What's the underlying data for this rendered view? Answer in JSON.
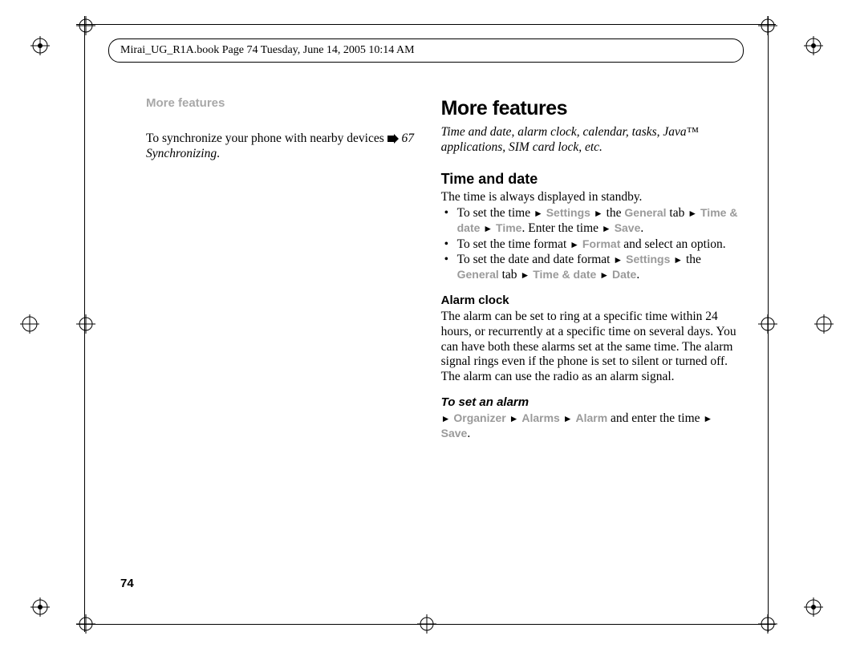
{
  "header": {
    "running_head": "Mirai_UG_R1A.book  Page 74  Tuesday, June 14, 2005  10:14 AM"
  },
  "left_col": {
    "section_label": "More features",
    "sync_text_1": "To synchronize your phone with nearby devices ",
    "sync_xref": "67 Synchronizing",
    "sync_text_2": "."
  },
  "right_col": {
    "big_heading": "More features",
    "tagline": "Time and date, alarm clock, calendar, tasks, Java™ applications, SIM card lock, etc.",
    "time_date_heading": "Time and date",
    "time_date_intro": "The time is always displayed in standby.",
    "bullets": {
      "b1": {
        "t1": "To set the time ",
        "m1": "Settings",
        "t2": " the ",
        "m2": "General",
        "t3": " tab ",
        "m3": "Time & date",
        "m4": "Time",
        "t4": ". Enter the time ",
        "m5": "Save",
        "t5": "."
      },
      "b2": {
        "t1": "To set the time format ",
        "m1": "Format",
        "t2": " and select an option."
      },
      "b3": {
        "t1": "To set the date and date format ",
        "m1": "Settings",
        "t2": " the ",
        "m2": "General",
        "t3": " tab ",
        "m3": "Time & date",
        "m4": "Date",
        "t4": "."
      }
    },
    "alarm_heading": "Alarm clock",
    "alarm_body": "The alarm can be set to ring at a specific time within 24 hours, or recurrently at a specific time on several days. You can have both these alarms set at the same time. The alarm signal rings even if the phone is set to silent or turned off. The alarm can use the radio as an alarm signal.",
    "set_alarm_heading": "To set an alarm",
    "set_alarm": {
      "m1": "Organizer",
      "m2": "Alarms",
      "m3": "Alarm",
      "t1": " and enter the time ",
      "m4": "Save",
      "t2": "."
    }
  },
  "page_number": "74"
}
